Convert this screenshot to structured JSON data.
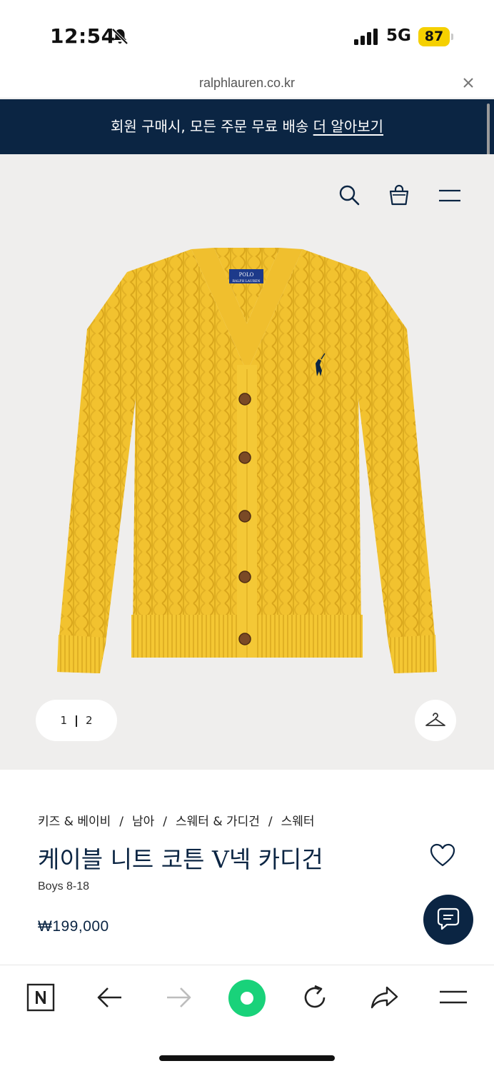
{
  "status_bar": {
    "time": "12:54",
    "network": "5G",
    "battery": "87"
  },
  "url_bar": {
    "url": "ralphlauren.co.kr"
  },
  "promo": {
    "text": "회원 구매시, 모든 주문 무료 배송 ",
    "link": "더 알아보기"
  },
  "hero": {
    "pager_current": "1",
    "pager_total": "2"
  },
  "product": {
    "breadcrumb": [
      "키즈 & 베이비",
      "남아",
      "스웨터 & 가디건",
      "스웨터"
    ],
    "breadcrumb_sep": "/",
    "title": "케이블 니트 코튼 V넥 카디건",
    "subtitle": "Boys 8-18",
    "price": "₩199,000",
    "label_top": "POLO",
    "label_bottom": "RALPH LAUREN"
  },
  "colors": {
    "navy": "#0b2543",
    "cardigan_yellow": "#f2c22f",
    "hero_bg": "#efeeed",
    "naver_green": "#19d27a"
  },
  "icons": {
    "status": [
      "bell-slash-icon",
      "signal-icon"
    ],
    "hero": [
      "search-icon",
      "shopping-bag-icon",
      "menu-icon",
      "hanger-icon"
    ],
    "product": [
      "heart-icon",
      "chat-icon"
    ],
    "browser": [
      "naver-n-icon",
      "back-arrow-icon",
      "forward-arrow-icon",
      "home-icon",
      "refresh-icon",
      "share-icon",
      "menu-icon"
    ]
  }
}
